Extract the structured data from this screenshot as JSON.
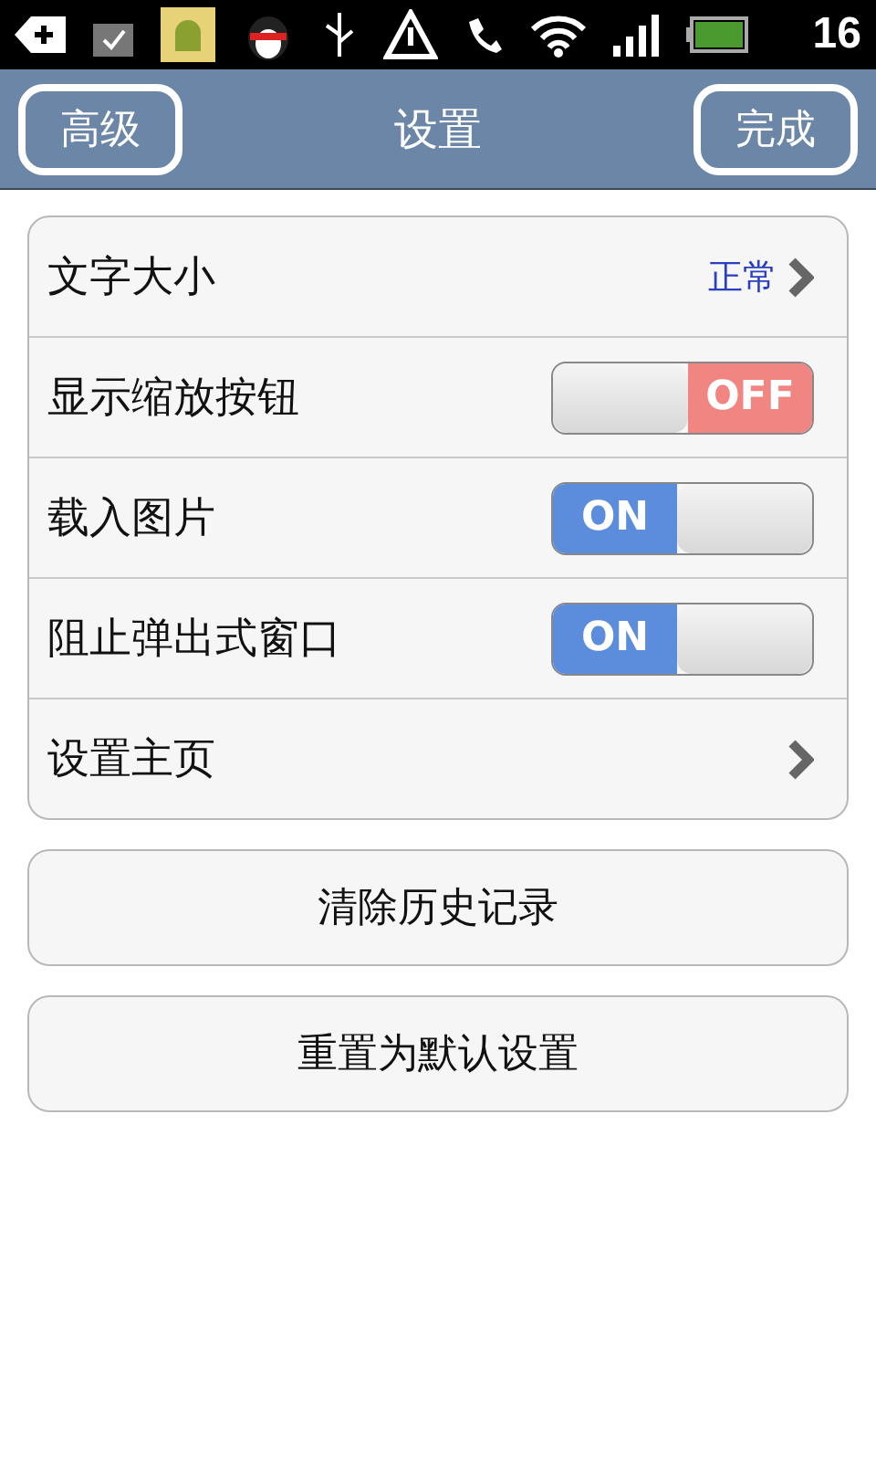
{
  "status_bar": {
    "time": "16"
  },
  "nav_bar": {
    "left_button": "高级",
    "title": "设置",
    "right_button": "完成"
  },
  "settings": [
    {
      "kind": "link",
      "label": "文字大小",
      "value": "正常"
    },
    {
      "kind": "toggle",
      "label": "显示缩放按钮",
      "on": false,
      "state_label": "OFF"
    },
    {
      "kind": "toggle",
      "label": "载入图片",
      "on": true,
      "state_label": "ON"
    },
    {
      "kind": "toggle",
      "label": "阻止弹出式窗口",
      "on": true,
      "state_label": "ON"
    },
    {
      "kind": "link",
      "label": "设置主页"
    }
  ],
  "buttons": [
    "清除历史记录",
    "重置为默认设置"
  ]
}
